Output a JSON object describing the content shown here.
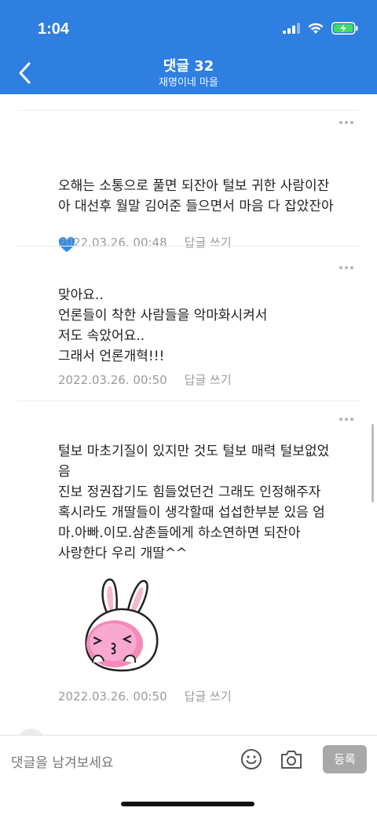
{
  "status_bar": {
    "time": "1:04"
  },
  "header": {
    "title": "댓글 32",
    "subtitle": "재명이네 마을"
  },
  "comments": [
    {
      "text": "오해는 소통으로 풀면 되잔아 털보 귀한 사람이잔\n아 대선후 월말 김어준 들으면서 마음 다 잡았잔아",
      "date": "2022.03.26. 00:48",
      "reply": "답글 쓰기"
    },
    {
      "text": "맞아요..\n언론들이 착한 사람들을  악마화시켜서\n저도 속았어요..\n그래서 언론개혁!!!",
      "date": "2022.03.26. 00:50",
      "reply": "답글 쓰기"
    },
    {
      "text": "털보 마초기질이 있지만 것도 털보 매력 털보없었\n음\n진보 정권잡기도 힘들었던건 그래도 인정해주자\n혹시라도 개딸들이 생각할때 섭섭한부분 있음 엄\n마.아빠.이모.삼촌들에게 하소연하면 되잔아\n 사랑한다 우리 개딸^^",
      "date": "2022.03.26. 00:50",
      "reply": "답글 쓰기"
    }
  ],
  "input_bar": {
    "placeholder": "댓글을 남겨보세요",
    "submit_label": "등록"
  },
  "icons": {
    "back": "chevron-left-icon",
    "more": "more-dots-icon",
    "emoji": "smile-icon",
    "camera": "camera-icon",
    "heart": "blue-heart-emoji"
  },
  "colors": {
    "header_bg": "#2f7fe0",
    "meta_text": "#9a9a9a",
    "submit_bg": "#a8a8a8"
  }
}
